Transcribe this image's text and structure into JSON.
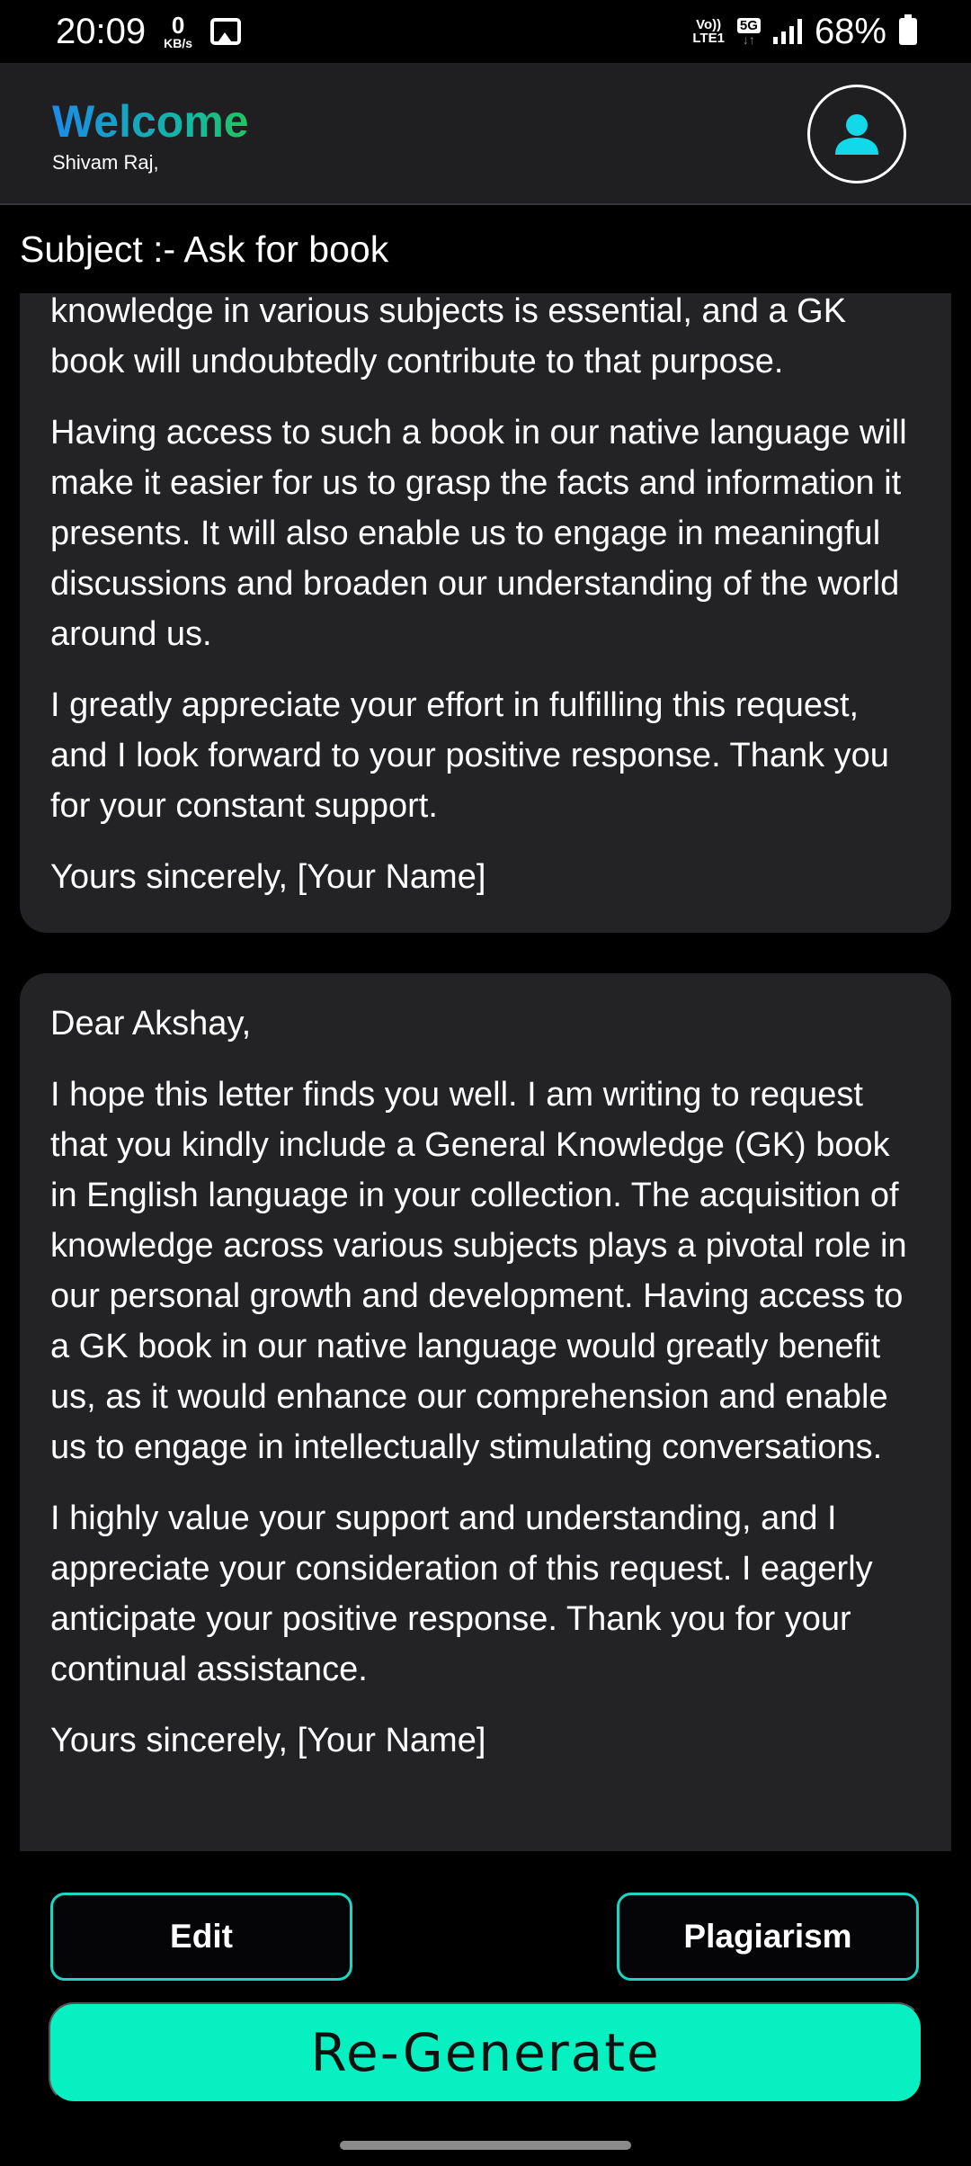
{
  "status_bar": {
    "time": "20:09",
    "net_speed_value": "0",
    "net_speed_unit": "KB/s",
    "volte_top": "Vo))",
    "volte_bottom": "LTE1",
    "network_type": "5G",
    "network_arrows": "↓↑",
    "battery_percent": "68%",
    "icons": [
      "gallery-icon",
      "signal-icon",
      "battery-icon"
    ]
  },
  "header": {
    "welcome": "Welcome",
    "user_name": "Shivam Raj,",
    "profile_icon": "person-icon",
    "colors": {
      "welcome_start": "#1a8ce8",
      "welcome_end": "#22c55e",
      "accent": "#06f0c2"
    }
  },
  "subject": "Subject :- Ask for book",
  "letters": [
    {
      "paragraphs": [
        "knowledge in various subjects is essential, and a GK book will undoubtedly contribute to that purpose.",
        "Having access to such a book in our native language will make it easier for us to grasp the facts and information it presents. It will also enable us to engage in meaningful discussions and broaden our understanding of the world around us.",
        "I greatly appreciate your effort in fulfilling this request, and I look forward to your positive response. Thank you for your constant support.",
        "Yours sincerely, [Your Name]"
      ]
    },
    {
      "paragraphs": [
        "Dear Akshay,",
        "I hope this letter finds you well. I am writing to request that you kindly include a General Knowledge (GK) book in English language in your collection. The acquisition of knowledge across various subjects plays a pivotal role in our personal growth and development. Having access to a GK book in our native language would greatly benefit us, as it would enhance our comprehension and enable us to engage in intellectually stimulating conversations.",
        "I highly value your support and understanding, and I appreciate your consideration of this request. I eagerly anticipate your positive response. Thank you for your continual assistance.",
        "Yours sincerely, [Your Name]"
      ]
    }
  ],
  "actions": {
    "edit": "Edit",
    "plagiarism": "Plagiarism",
    "regenerate": "Re-Generate"
  }
}
